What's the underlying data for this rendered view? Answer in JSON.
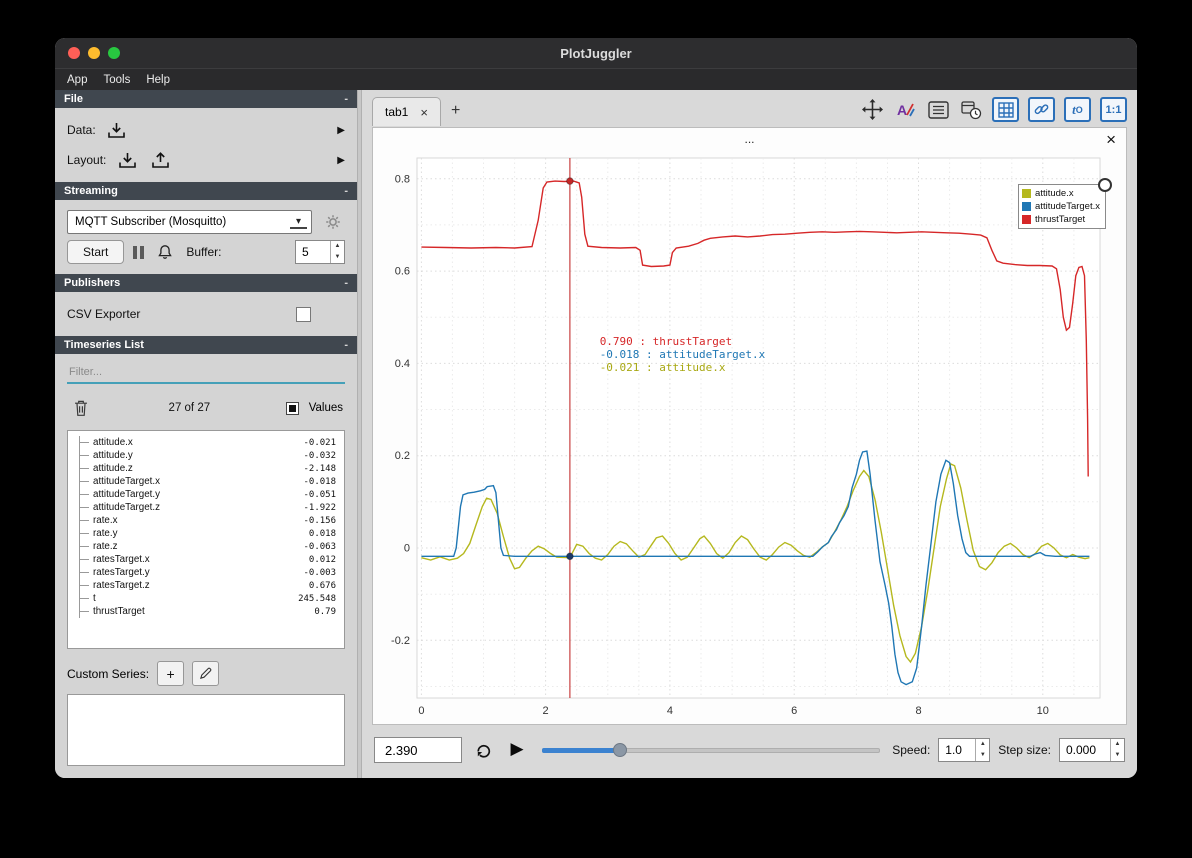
{
  "window": {
    "title": "PlotJuggler"
  },
  "menubar": {
    "items": [
      "App",
      "Tools",
      "Help"
    ]
  },
  "icons": {
    "expand": "▶",
    "collapse": "-",
    "close": "×",
    "play": "▶",
    "spin_up": "▲",
    "spin_down": "▼",
    "dropdown": "▾",
    "add": "+",
    "ellipsis": "..."
  },
  "sidebar": {
    "collapse_glyph": "-",
    "file": {
      "title": "File",
      "data_label": "Data:",
      "layout_label": "Layout:"
    },
    "streaming": {
      "title": "Streaming",
      "source": "MQTT Subscriber (Mosquitto)",
      "start_label": "Start",
      "buffer_label": "Buffer:",
      "buffer_value": "5"
    },
    "publishers": {
      "title": "Publishers",
      "csv_label": "CSV Exporter"
    },
    "timeseries": {
      "title": "Timeseries List",
      "filter_placeholder": "Filter...",
      "count": "27 of 27",
      "values_label": "Values",
      "custom_label": "Custom Series:",
      "items": [
        {
          "name": "attitude.x",
          "value": "-0.021"
        },
        {
          "name": "attitude.y",
          "value": "-0.032"
        },
        {
          "name": "attitude.z",
          "value": "-2.148"
        },
        {
          "name": "attitudeTarget.x",
          "value": "-0.018"
        },
        {
          "name": "attitudeTarget.y",
          "value": "-0.051"
        },
        {
          "name": "attitudeTarget.z",
          "value": "-1.922"
        },
        {
          "name": "rate.x",
          "value": "-0.156"
        },
        {
          "name": "rate.y",
          "value": "0.018"
        },
        {
          "name": "rate.z",
          "value": "-0.063"
        },
        {
          "name": "ratesTarget.x",
          "value": "0.012"
        },
        {
          "name": "ratesTarget.y",
          "value": "-0.003"
        },
        {
          "name": "ratesTarget.z",
          "value": "0.676"
        },
        {
          "name": "t",
          "value": "245.548"
        },
        {
          "name": "thrustTarget",
          "value": "0.79"
        }
      ]
    }
  },
  "main": {
    "tab_label": "tab1",
    "plot_title": "..."
  },
  "toolbar": {
    "t0_main": "t",
    "t0_sub": "O",
    "ratio_label": "1:1"
  },
  "bottombar": {
    "time_value": "2.390",
    "speed_label": "Speed:",
    "speed_value": "1.0",
    "step_label": "Step size:",
    "step_value": "0.000"
  },
  "chart_data": {
    "type": "line",
    "title": "...",
    "xlabel": "",
    "ylabel": "",
    "xlim": [
      -0.07,
      10.92
    ],
    "ylim": [
      -0.325,
      0.845
    ],
    "x_ticks": [
      0,
      2,
      4,
      6,
      8,
      10
    ],
    "y_ticks": [
      -0.2,
      0,
      0.2,
      0.4,
      0.6,
      0.8
    ],
    "grid": true,
    "legend_position": "top-right",
    "tracker": {
      "x": 2.39,
      "readouts": [
        {
          "label": " 0.790 : thrustTarget",
          "color": "#d62728"
        },
        {
          "label": "-0.018 : attitudeTarget.x",
          "color": "#1f77b4"
        },
        {
          "label": "-0.021 : attitude.x",
          "color": "#a8a812"
        }
      ],
      "dots": [
        {
          "y": 0.795,
          "color": "#c42828"
        },
        {
          "y": -0.018,
          "color": "#1b3a68"
        }
      ]
    },
    "series": [
      {
        "name": "attitude.x",
        "color": "#b5b81e",
        "points": [
          [
            0,
            -0.021
          ],
          [
            0.15,
            -0.026
          ],
          [
            0.3,
            -0.019
          ],
          [
            0.45,
            -0.026
          ],
          [
            0.58,
            -0.022
          ],
          [
            0.68,
            -0.012
          ],
          [
            0.78,
            0.01
          ],
          [
            0.88,
            0.05
          ],
          [
            0.98,
            0.09
          ],
          [
            1.05,
            0.108
          ],
          [
            1.12,
            0.105
          ],
          [
            1.22,
            0.075
          ],
          [
            1.32,
            0.025
          ],
          [
            1.42,
            -0.022
          ],
          [
            1.5,
            -0.045
          ],
          [
            1.58,
            -0.042
          ],
          [
            1.68,
            -0.022
          ],
          [
            1.78,
            -0.006
          ],
          [
            1.88,
            0.004
          ],
          [
            1.98,
            -0.002
          ],
          [
            2.08,
            -0.012
          ],
          [
            2.18,
            -0.02
          ],
          [
            2.39,
            -0.021
          ],
          [
            2.5,
            0.008
          ],
          [
            2.6,
            0.004
          ],
          [
            2.7,
            -0.012
          ],
          [
            2.8,
            -0.022
          ],
          [
            2.9,
            -0.026
          ],
          [
            3.0,
            -0.014
          ],
          [
            3.1,
            0.004
          ],
          [
            3.2,
            0.014
          ],
          [
            3.3,
            0.009
          ],
          [
            3.4,
            -0.006
          ],
          [
            3.5,
            -0.02
          ],
          [
            3.6,
            -0.014
          ],
          [
            3.7,
            0.006
          ],
          [
            3.78,
            0.022
          ],
          [
            3.88,
            0.026
          ],
          [
            3.98,
            0.01
          ],
          [
            4.08,
            -0.012
          ],
          [
            4.18,
            -0.026
          ],
          [
            4.28,
            -0.02
          ],
          [
            4.38,
            0.0
          ],
          [
            4.48,
            0.02
          ],
          [
            4.55,
            0.026
          ],
          [
            4.65,
            0.01
          ],
          [
            4.75,
            -0.012
          ],
          [
            4.85,
            -0.022
          ],
          [
            4.95,
            -0.01
          ],
          [
            5.05,
            0.012
          ],
          [
            5.15,
            0.026
          ],
          [
            5.25,
            0.018
          ],
          [
            5.35,
            -0.002
          ],
          [
            5.45,
            -0.02
          ],
          [
            5.55,
            -0.026
          ],
          [
            5.65,
            -0.014
          ],
          [
            5.75,
            0.002
          ],
          [
            5.85,
            0.012
          ],
          [
            5.95,
            0.006
          ],
          [
            6.05,
            -0.006
          ],
          [
            6.15,
            -0.016
          ],
          [
            6.25,
            -0.02
          ],
          [
            6.35,
            -0.01
          ],
          [
            6.45,
            0.002
          ],
          [
            6.55,
            0.012
          ],
          [
            6.65,
            0.035
          ],
          [
            6.75,
            0.06
          ],
          [
            6.85,
            0.09
          ],
          [
            6.95,
            0.125
          ],
          [
            7.05,
            0.155
          ],
          [
            7.12,
            0.168
          ],
          [
            7.2,
            0.155
          ],
          [
            7.3,
            0.105
          ],
          [
            7.4,
            0.035
          ],
          [
            7.5,
            -0.045
          ],
          [
            7.6,
            -0.125
          ],
          [
            7.7,
            -0.19
          ],
          [
            7.8,
            -0.235
          ],
          [
            7.87,
            -0.247
          ],
          [
            7.95,
            -0.228
          ],
          [
            8.05,
            -0.17
          ],
          [
            8.15,
            -0.09
          ],
          [
            8.25,
            0.0
          ],
          [
            8.35,
            0.09
          ],
          [
            8.45,
            0.15
          ],
          [
            8.52,
            0.182
          ],
          [
            8.58,
            0.178
          ],
          [
            8.68,
            0.13
          ],
          [
            8.78,
            0.06
          ],
          [
            8.88,
            -0.005
          ],
          [
            8.98,
            -0.04
          ],
          [
            9.08,
            -0.047
          ],
          [
            9.18,
            -0.032
          ],
          [
            9.28,
            -0.01
          ],
          [
            9.38,
            0.004
          ],
          [
            9.48,
            0.01
          ],
          [
            9.58,
            0.0
          ],
          [
            9.68,
            -0.014
          ],
          [
            9.78,
            -0.021
          ],
          [
            9.88,
            -0.012
          ],
          [
            9.98,
            0.004
          ],
          [
            10.08,
            0.01
          ],
          [
            10.18,
            0.0
          ],
          [
            10.28,
            -0.015
          ],
          [
            10.38,
            -0.021
          ],
          [
            10.48,
            -0.014
          ],
          [
            10.58,
            -0.02
          ],
          [
            10.68,
            -0.023
          ],
          [
            10.75,
            -0.021
          ]
        ]
      },
      {
        "name": "attitudeTarget.x",
        "color": "#1f77b4",
        "points": [
          [
            0,
            -0.018
          ],
          [
            0.52,
            -0.018
          ],
          [
            0.56,
            0.0
          ],
          [
            0.6,
            0.05
          ],
          [
            0.63,
            0.09
          ],
          [
            0.67,
            0.115
          ],
          [
            0.75,
            0.119
          ],
          [
            0.85,
            0.121
          ],
          [
            0.95,
            0.124
          ],
          [
            1.02,
            0.127
          ],
          [
            1.06,
            0.133
          ],
          [
            1.16,
            0.135
          ],
          [
            1.2,
            0.12
          ],
          [
            1.24,
            0.06
          ],
          [
            1.28,
            0.0
          ],
          [
            1.32,
            -0.016
          ],
          [
            1.5,
            -0.018
          ],
          [
            2.5,
            -0.018
          ],
          [
            4.0,
            -0.018
          ],
          [
            5.5,
            -0.018
          ],
          [
            6.3,
            -0.018
          ],
          [
            6.38,
            -0.008
          ],
          [
            6.45,
            0.002
          ],
          [
            6.55,
            0.012
          ],
          [
            6.6,
            0.025
          ],
          [
            6.68,
            0.04
          ],
          [
            6.73,
            0.055
          ],
          [
            6.8,
            0.07
          ],
          [
            6.87,
            0.09
          ],
          [
            6.93,
            0.13
          ],
          [
            7.0,
            0.16
          ],
          [
            7.05,
            0.19
          ],
          [
            7.1,
            0.208
          ],
          [
            7.17,
            0.21
          ],
          [
            7.22,
            0.16
          ],
          [
            7.3,
            0.06
          ],
          [
            7.38,
            -0.03
          ],
          [
            7.46,
            -0.08
          ],
          [
            7.52,
            -0.12
          ],
          [
            7.57,
            -0.17
          ],
          [
            7.62,
            -0.23
          ],
          [
            7.67,
            -0.27
          ],
          [
            7.72,
            -0.29
          ],
          [
            7.8,
            -0.296
          ],
          [
            7.9,
            -0.29
          ],
          [
            7.97,
            -0.26
          ],
          [
            8.05,
            -0.17
          ],
          [
            8.12,
            -0.08
          ],
          [
            8.2,
            0.01
          ],
          [
            8.28,
            0.1
          ],
          [
            8.36,
            0.16
          ],
          [
            8.44,
            0.19
          ],
          [
            8.5,
            0.185
          ],
          [
            8.56,
            0.14
          ],
          [
            8.63,
            0.07
          ],
          [
            8.7,
            0.02
          ],
          [
            8.76,
            -0.01
          ],
          [
            8.82,
            -0.018
          ],
          [
            9.2,
            -0.018
          ],
          [
            9.8,
            -0.018
          ],
          [
            9.88,
            -0.013
          ],
          [
            9.96,
            -0.01
          ],
          [
            10.04,
            -0.016
          ],
          [
            10.2,
            -0.018
          ],
          [
            10.75,
            -0.018
          ]
        ]
      },
      {
        "name": "thrustTarget",
        "color": "#d62728",
        "points": [
          [
            0,
            0.652
          ],
          [
            0.4,
            0.651
          ],
          [
            0.8,
            0.65
          ],
          [
            1.2,
            0.651
          ],
          [
            1.5,
            0.65
          ],
          [
            1.78,
            0.653
          ],
          [
            1.88,
            0.71
          ],
          [
            1.96,
            0.78
          ],
          [
            2.02,
            0.793
          ],
          [
            2.15,
            0.795
          ],
          [
            2.3,
            0.794
          ],
          [
            2.45,
            0.795
          ],
          [
            2.54,
            0.791
          ],
          [
            2.58,
            0.76
          ],
          [
            2.63,
            0.68
          ],
          [
            2.68,
            0.654
          ],
          [
            2.9,
            0.651
          ],
          [
            3.2,
            0.65
          ],
          [
            3.45,
            0.651
          ],
          [
            3.52,
            0.645
          ],
          [
            3.56,
            0.613
          ],
          [
            3.7,
            0.61
          ],
          [
            3.9,
            0.611
          ],
          [
            4.0,
            0.613
          ],
          [
            4.04,
            0.64
          ],
          [
            4.1,
            0.65
          ],
          [
            4.3,
            0.654
          ],
          [
            4.45,
            0.66
          ],
          [
            4.55,
            0.667
          ],
          [
            4.65,
            0.671
          ],
          [
            4.85,
            0.674
          ],
          [
            5.05,
            0.676
          ],
          [
            5.25,
            0.674
          ],
          [
            5.45,
            0.676
          ],
          [
            5.65,
            0.679
          ],
          [
            5.85,
            0.68
          ],
          [
            6.05,
            0.682
          ],
          [
            6.25,
            0.684
          ],
          [
            6.45,
            0.685
          ],
          [
            6.65,
            0.684
          ],
          [
            6.85,
            0.685
          ],
          [
            7.05,
            0.686
          ],
          [
            7.25,
            0.685
          ],
          [
            7.45,
            0.684
          ],
          [
            7.65,
            0.683
          ],
          [
            7.85,
            0.684
          ],
          [
            8.05,
            0.685
          ],
          [
            8.25,
            0.684
          ],
          [
            8.45,
            0.683
          ],
          [
            8.65,
            0.682
          ],
          [
            8.85,
            0.68
          ],
          [
            9.0,
            0.678
          ],
          [
            9.1,
            0.672
          ],
          [
            9.18,
            0.645
          ],
          [
            9.26,
            0.622
          ],
          [
            9.36,
            0.617
          ],
          [
            9.55,
            0.614
          ],
          [
            9.75,
            0.612
          ],
          [
            9.95,
            0.612
          ],
          [
            10.15,
            0.611
          ],
          [
            10.22,
            0.605
          ],
          [
            10.28,
            0.56
          ],
          [
            10.33,
            0.5
          ],
          [
            10.38,
            0.472
          ],
          [
            10.43,
            0.478
          ],
          [
            10.48,
            0.53
          ],
          [
            10.53,
            0.59
          ],
          [
            10.58,
            0.608
          ],
          [
            10.63,
            0.61
          ],
          [
            10.67,
            0.59
          ],
          [
            10.7,
            0.45
          ],
          [
            10.72,
            0.28
          ],
          [
            10.73,
            0.155
          ]
        ]
      }
    ]
  }
}
